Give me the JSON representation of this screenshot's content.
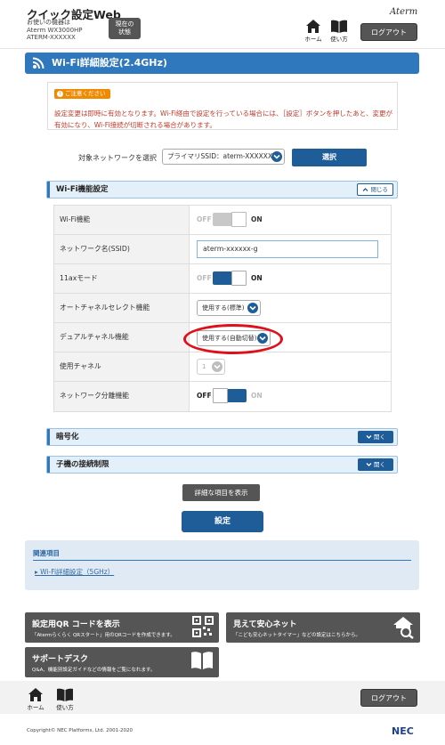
{
  "header": {
    "app_title": "クイック設定Web",
    "device_label": "お使いの機器は",
    "device_model": "Aterm WX3000HP",
    "device_id": "ATERM-XXXXXX",
    "status_button": "現在の\n状態",
    "home_label": "ホーム",
    "help_label": "使い方",
    "logo": "Aterm",
    "logout": "ログアウト"
  },
  "page": {
    "title": "Wi-Fi詳細設定(2.4GHz)"
  },
  "caution": {
    "badge": "ご注意ください",
    "text": "設定変更は即時に有効となります。Wi-Fi経由で設定を行っている場合には、［設定］ボタンを押したあと、変更が有効になり、Wi-Fi接続が切断される場合があります。"
  },
  "network_select": {
    "label": "対象ネットワークを選択",
    "value": "プライマリSSID：aterm-XXXXXX-g",
    "button": "選択"
  },
  "wifi_function": {
    "section_title": "Wi-Fi機能設定",
    "collapse_label": "閉じる",
    "rows": [
      {
        "label": "Wi-Fi機能",
        "type": "switch",
        "off": "OFF",
        "on": "ON",
        "state": "on-disabled"
      },
      {
        "label": "ネットワーク名(SSID)",
        "type": "text",
        "value": "aterm-xxxxxx-g"
      },
      {
        "label": "11axモード",
        "type": "switch",
        "off": "OFF",
        "on": "ON",
        "state": "on"
      },
      {
        "label": "オートチャネルセレクト機能",
        "type": "select",
        "value": "使用する(標準)"
      },
      {
        "label": "デュアルチャネル機能",
        "type": "select",
        "value": "使用する(自動切替)"
      },
      {
        "label": "使用チャネル",
        "type": "select-disabled",
        "value": "1"
      },
      {
        "label": "ネットワーク分離機能",
        "type": "switch",
        "off": "OFF",
        "on": "ON",
        "state": "off"
      }
    ]
  },
  "encryption": {
    "section_title": "暗号化",
    "expand_label": "開く"
  },
  "child_limit": {
    "section_title": "子機の接続制限",
    "expand_label": "開く"
  },
  "buttons": {
    "show_details": "詳細な項目を表示",
    "apply": "設定"
  },
  "related": {
    "title": "関連項目",
    "link": "Wi-Fi詳細設定（5GHz）"
  },
  "tiles": [
    {
      "title": "設定用QR コードを表示",
      "sub": "「Atermらくらく QRスタート」用のQRコードを作成できます。",
      "icon": "qr-code-icon"
    },
    {
      "title": "見えて安心ネット",
      "sub": "「こども安心ネットタイマー」などの設定はこちらから。",
      "icon": "home-search-icon"
    },
    {
      "title": "サポートデスク",
      "sub": "Q&A、機能別設定ガイドなどの情報をご覧になれます。",
      "icon": "book-icon"
    }
  ],
  "footer": {
    "home_label": "ホーム",
    "help_label": "使い方",
    "logout": "ログアウト",
    "copyright": "Copyright© NEC Platforms, Ltd. 2001-2020",
    "brand": "NEC"
  },
  "colors": {
    "primary": "#2f78bd",
    "button_blue": "#1f5d99",
    "button_gray": "#555555",
    "caution_red": "#c0392b",
    "caution_orange": "#f08a00",
    "highlight_red": "#e0101a"
  }
}
